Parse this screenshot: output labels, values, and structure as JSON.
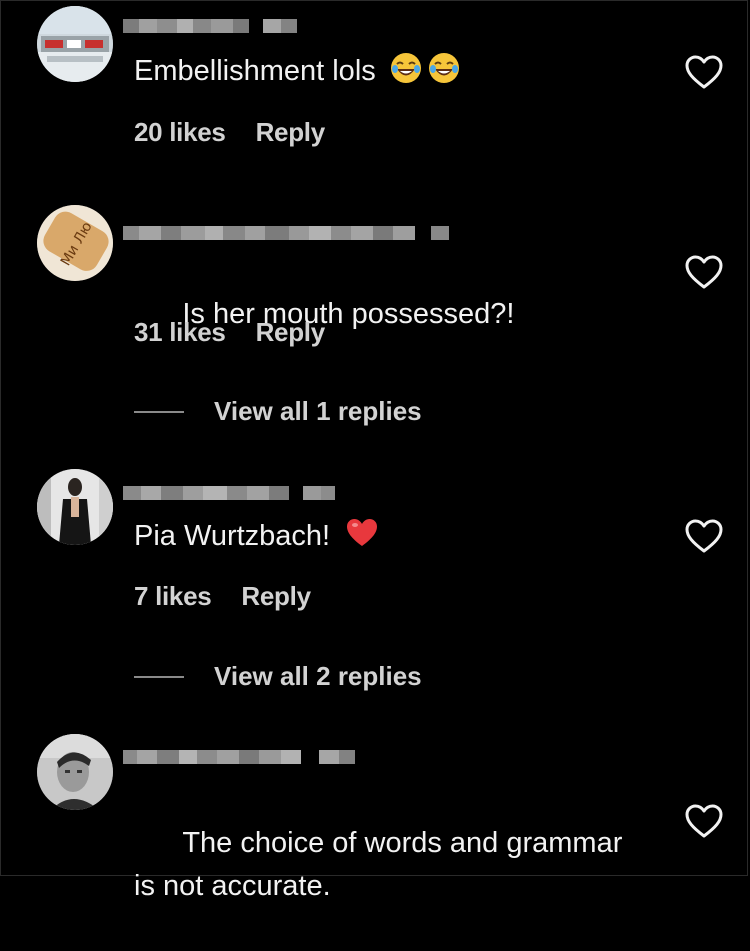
{
  "comments": [
    {
      "text": "Embellishment lols",
      "likes": "20 likes",
      "reply": "Reply",
      "emojis": [
        "laughing-emoji",
        "laughing-emoji"
      ]
    },
    {
      "text": "Is her mouth possessed?!",
      "likes": "31 likes",
      "reply": "Reply",
      "view_replies": "View all 1 replies"
    },
    {
      "text": "Pia Wurtzbach!",
      "likes": "7 likes",
      "reply": "Reply",
      "emojis": [
        "red-heart-emoji"
      ],
      "view_replies": "View all 2 replies"
    },
    {
      "text": "The choice of words and grammar\nis not accurate."
    }
  ],
  "icons": {
    "like": "heart-outline-icon"
  },
  "colors": {
    "background": "#000000",
    "text": "#f2f2f2",
    "meta": "#d2d2d2",
    "heart_emoji": "#e8383d"
  }
}
